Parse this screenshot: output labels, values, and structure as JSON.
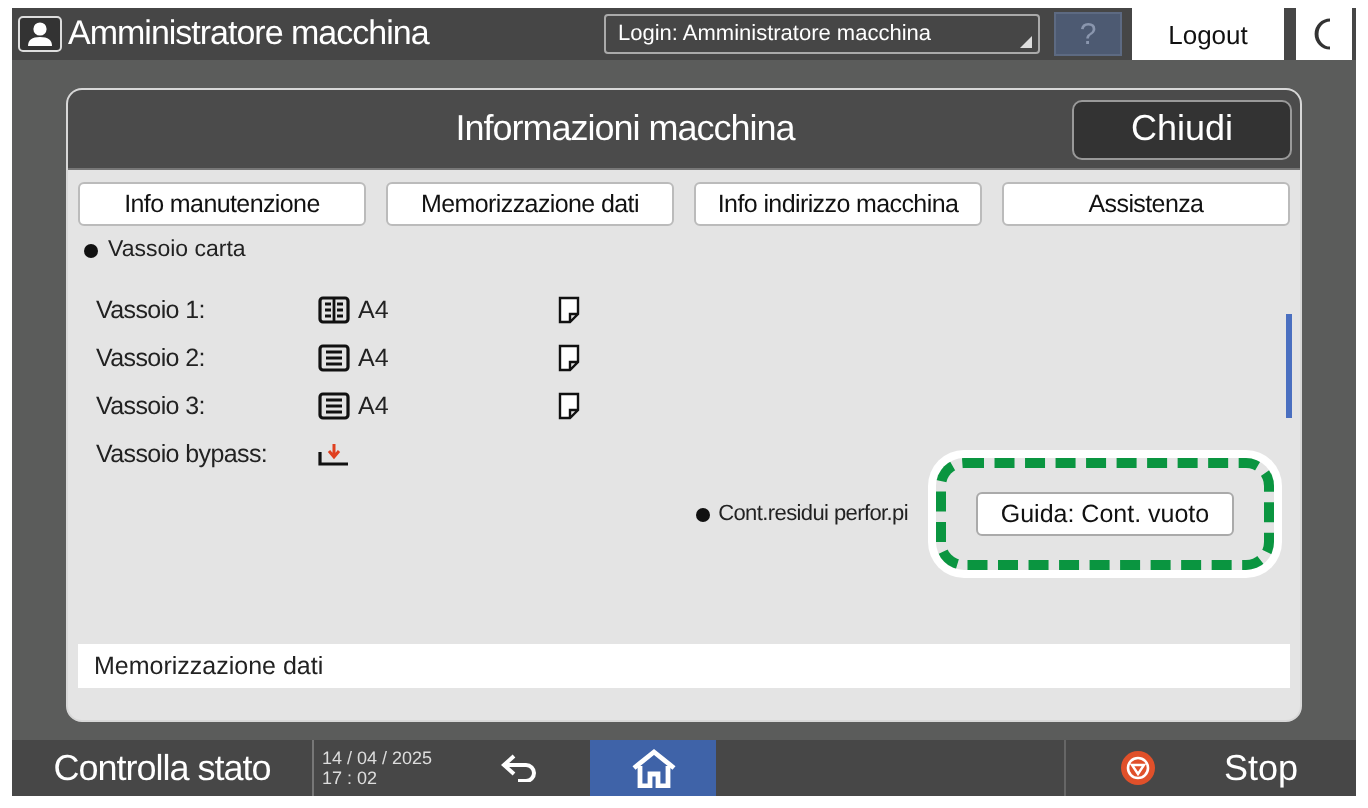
{
  "header": {
    "user": "Amministratore macchina",
    "login": "Login: Amministratore macchina",
    "help": "?",
    "logout": "Logout"
  },
  "dialog": {
    "title": "Informazioni macchina",
    "close": "Chiudi",
    "tabs": [
      {
        "label": "Info manutenzione",
        "selected": false
      },
      {
        "label": "Memorizzazione dati",
        "selected": false
      },
      {
        "label": "Info indirizzo macchina",
        "selected": false
      },
      {
        "label": "Assistenza",
        "selected": false
      }
    ],
    "section": "Vassoio carta",
    "trays": [
      {
        "label": "Vassoio 1:",
        "kind": "large",
        "size": "A4"
      },
      {
        "label": "Vassoio 2:",
        "kind": "standard",
        "size": "A4"
      },
      {
        "label": "Vassoio 3:",
        "kind": "standard",
        "size": "A4"
      },
      {
        "label": "Vassoio bypass:",
        "kind": "bypass"
      }
    ],
    "waste": {
      "label": "Cont.residui perfor.pi",
      "button": "Guida: Cont. vuoto"
    },
    "footer": "Memorizzazione dati"
  },
  "bottom_bar": {
    "status": "Controlla stato",
    "date": "14 / 04 / 2025",
    "time": "17 : 02",
    "stop": "Stop"
  }
}
